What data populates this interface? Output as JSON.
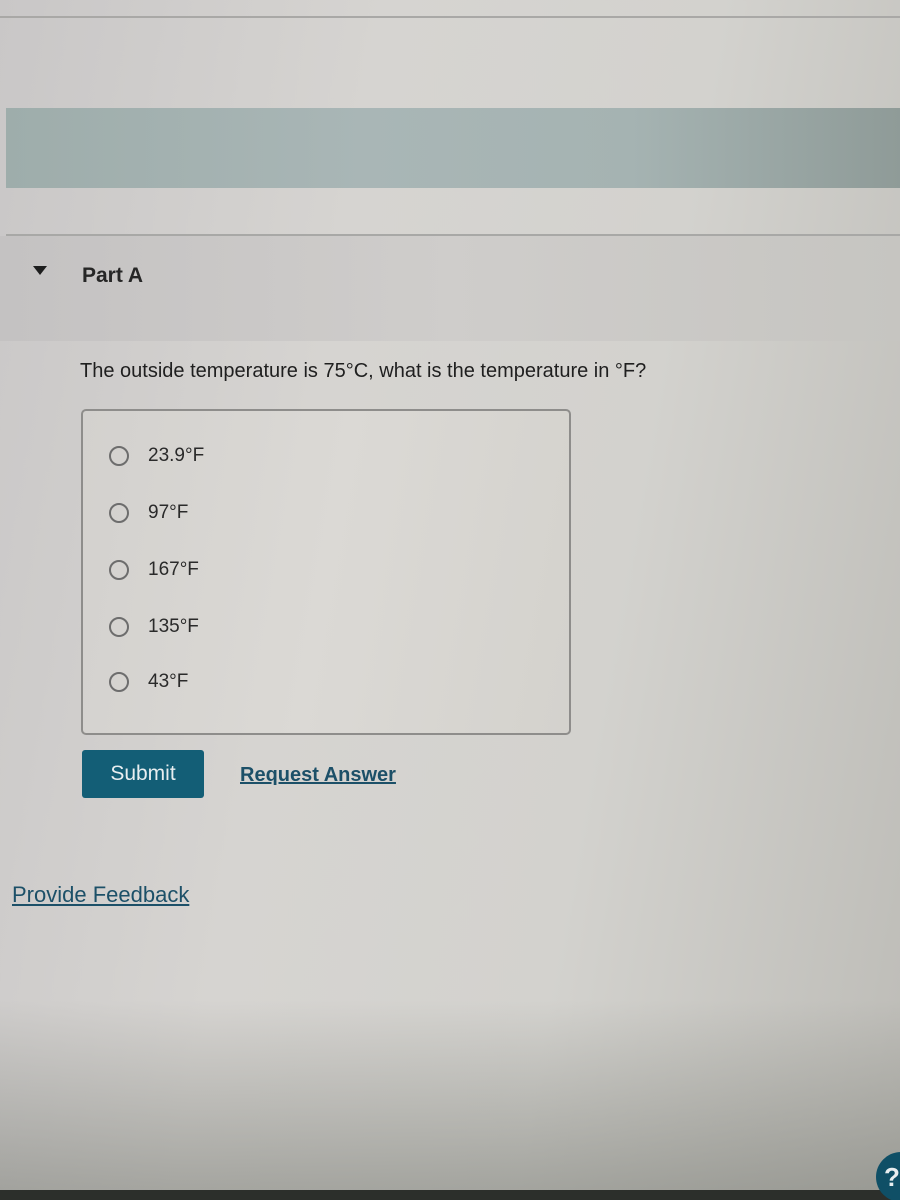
{
  "part": {
    "title": "Part A",
    "expanded": true
  },
  "question": {
    "text": "The outside temperature is 75°C, what is the temperature in °F?"
  },
  "choices": [
    {
      "label": "23.9°F",
      "selected": false
    },
    {
      "label": "97°F",
      "selected": false
    },
    {
      "label": "167°F",
      "selected": false
    },
    {
      "label": "135°F",
      "selected": false
    },
    {
      "label": "43°F",
      "selected": false
    }
  ],
  "actions": {
    "submit_label": "Submit",
    "request_answer_label": "Request Answer",
    "provide_feedback_label": "Provide Feedback"
  },
  "help": {
    "icon": "help-icon",
    "glyph": "?"
  },
  "colors": {
    "primary": "#135e76",
    "link": "#1c5068"
  }
}
